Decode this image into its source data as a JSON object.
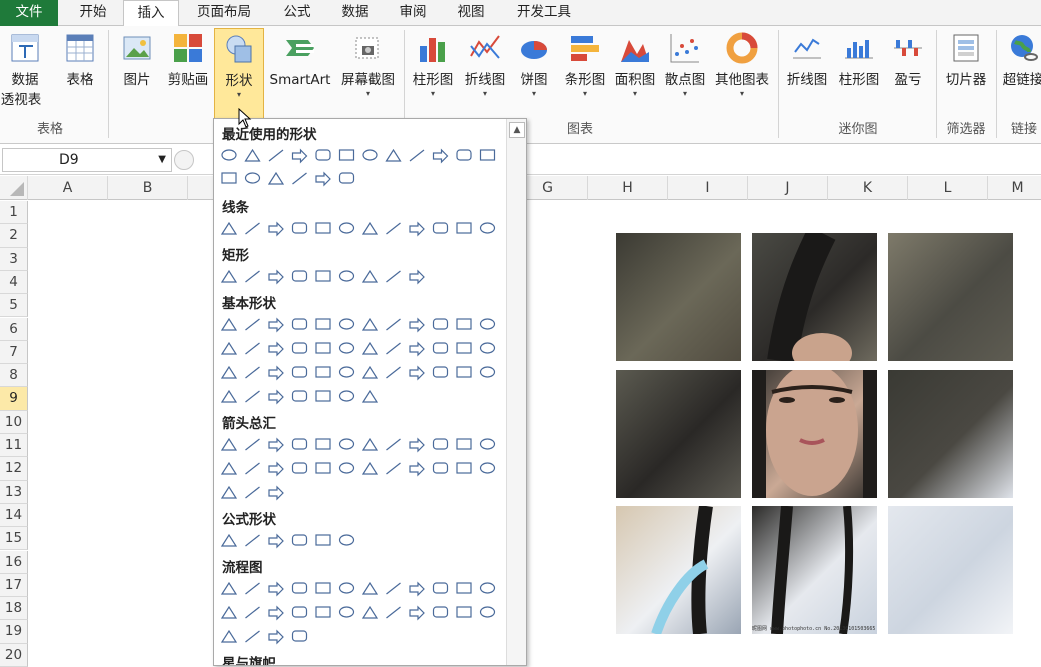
{
  "menu": {
    "file": "文件",
    "tabs": [
      "开始",
      "插入",
      "页面布局",
      "公式",
      "数据",
      "审阅",
      "视图",
      "开发工具"
    ]
  },
  "ribbon": {
    "pivot": {
      "label": "数据",
      "label2": "透视表"
    },
    "table": "表格",
    "picture": "图片",
    "clipart": "剪贴画",
    "shapes": "形状",
    "smartart": "SmartArt",
    "screenshot": "屏幕截图",
    "charts": [
      "柱形图",
      "折线图",
      "饼图",
      "条形图",
      "面积图",
      "散点图",
      "其他图表"
    ],
    "sparklines": [
      "折线图",
      "柱形图",
      "盈亏"
    ],
    "slicer": "切片器",
    "hyperlink": "超链接",
    "groups": {
      "tables": "表格",
      "charts": "图表",
      "sparklines": "迷你图",
      "filter": "筛选器",
      "links": "链接"
    }
  },
  "formula_bar": {
    "name_box": "D9"
  },
  "columns": [
    "A",
    "B",
    "G",
    "H",
    "I",
    "J",
    "K",
    "L",
    "M"
  ],
  "rows": [
    "1",
    "2",
    "3",
    "4",
    "5",
    "6",
    "7",
    "8",
    "9",
    "10",
    "11",
    "12",
    "13",
    "14",
    "15",
    "16",
    "17",
    "18",
    "19",
    "20"
  ],
  "selected_row": "9",
  "shapes_menu": {
    "sections": [
      "最近使用的形状",
      "线条",
      "矩形",
      "基本形状",
      "箭头总汇",
      "公式形状",
      "流程图",
      "星与旗帜"
    ]
  },
  "photo": {
    "watermark": "昵图网 www.photophoto.cn No.20130101503665"
  }
}
